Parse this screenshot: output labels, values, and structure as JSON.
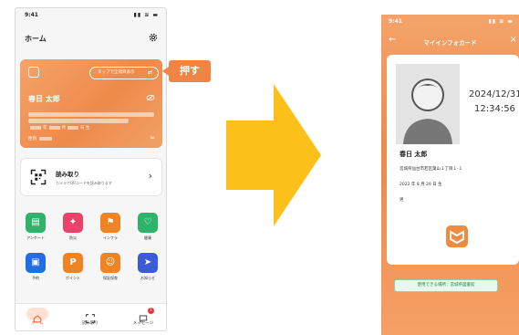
{
  "left": {
    "status_time": "9:41",
    "header_title": "ホーム",
    "card": {
      "tap_label": "タップで全項目表示",
      "name": "春日 太郎",
      "dob_parts": [
        "年",
        "月",
        "日 生"
      ],
      "sex_label": "性別"
    },
    "scan": {
      "title": "読み取り",
      "subtitle": "カメラでQRコードを読み取ります"
    },
    "apps": [
      {
        "label": "アンケート",
        "color": "#2fb36a",
        "icon": "chat-icon"
      },
      {
        "label": "防災",
        "color": "#e9426b",
        "icon": "runner-icon"
      },
      {
        "label": "インフラ",
        "color": "#f08422",
        "icon": "flag-icon"
      },
      {
        "label": "健康",
        "color": "#2fb36a",
        "icon": "health-icon"
      },
      {
        "label": "予約",
        "color": "#1f6fe0",
        "icon": "calendar-icon"
      },
      {
        "label": "ポイント",
        "color": "#f08422",
        "icon": "point-icon"
      },
      {
        "label": "保証保育",
        "color": "#f08422",
        "icon": "smile-icon"
      },
      {
        "label": "お知らせ",
        "color": "#3b5cd6",
        "icon": "send-icon"
      }
    ],
    "tabs": [
      {
        "label": "ホーム",
        "icon": "home-icon",
        "active": true
      },
      {
        "label": "読み取り",
        "icon": "scan-icon",
        "active": false
      },
      {
        "label": "メッセージ",
        "icon": "message-icon",
        "active": false,
        "badge": "1"
      }
    ]
  },
  "callout_text": "押す",
  "right": {
    "status_time": "9:41",
    "title": "マイインフォカード",
    "date": "2024/12/31",
    "time": "12:34:56",
    "name": "春日 太郎",
    "address": "宮城県仙台市若区葉山１丁目１-１",
    "dob": "2022 年 8 月 29 日 生",
    "sex": "男",
    "usage_place": "使用できる場所：宮城県図書館"
  },
  "colors": {
    "accent": "#ef8444",
    "arrow": "#fbc01a"
  }
}
